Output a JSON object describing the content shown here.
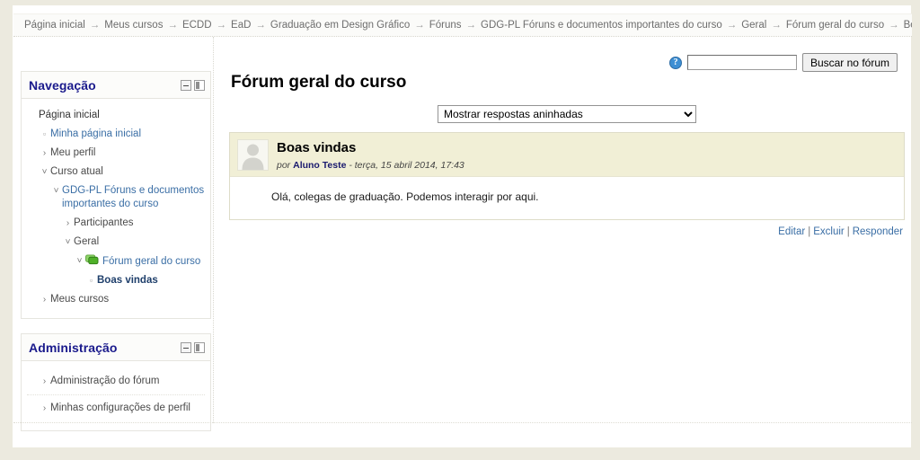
{
  "breadcrumb": {
    "separator": "→",
    "items": [
      "Página inicial",
      "Meus cursos",
      "ECDD",
      "EaD",
      "Graduação em Design Gráfico",
      "Fóruns",
      "GDG-PL Fóruns e documentos importantes do curso",
      "Geral",
      "Fórum geral do curso",
      "Boas vindas"
    ]
  },
  "search": {
    "help_icon": "help-icon",
    "input_value": "",
    "placeholder": "",
    "button_label": "Buscar no fórum"
  },
  "blocks": {
    "navigation": {
      "title": "Navegação",
      "hide_icon": "minus-icon",
      "dock_icon": "dock-icon",
      "items": [
        {
          "label": "Página inicial",
          "marker": "",
          "depth": 0,
          "style": "plain"
        },
        {
          "label": "Minha página inicial",
          "marker": "▫",
          "depth": 1,
          "style": "link"
        },
        {
          "label": "Meu perfil",
          "marker": "›",
          "depth": 1,
          "style": "muted"
        },
        {
          "label": "Curso atual",
          "marker": "˅",
          "depth": 1,
          "style": "muted"
        },
        {
          "label": "GDG-PL Fóruns e documentos importantes do curso",
          "marker": "˅",
          "depth": 2,
          "style": "link"
        },
        {
          "label": "Participantes",
          "marker": "›",
          "depth": 3,
          "style": "muted"
        },
        {
          "label": "Geral",
          "marker": "˅",
          "depth": 3,
          "style": "muted"
        },
        {
          "label": "Fórum geral do curso",
          "marker": "˅",
          "depth": 4,
          "style": "link",
          "icon": "forum-icon"
        },
        {
          "label": "Boas vindas",
          "marker": "▫",
          "depth": 5,
          "style": "bold"
        },
        {
          "label": "Meus cursos",
          "marker": "›",
          "depth": 1,
          "style": "muted"
        }
      ]
    },
    "administration": {
      "title": "Administração",
      "hide_icon": "minus-icon",
      "dock_icon": "dock-icon",
      "items": [
        {
          "label": "Administração do fórum",
          "marker": "›"
        },
        {
          "label": "Minhas configurações de perfil",
          "marker": "›"
        }
      ]
    }
  },
  "main": {
    "page_title": "Fórum geral do curso",
    "display_mode": "Mostrar respostas aninhadas",
    "display_mode_options": [
      "Mostrar respostas aninhadas"
    ],
    "post": {
      "subject": "Boas vindas",
      "by_prefix": "por",
      "author": "Aluno Teste",
      "date": "- terça, 15 abril 2014, 17:43",
      "body": "Olá, colegas de graduação. Podemos interagir por aqui.",
      "avatar_icon": "user-avatar-icon",
      "actions": [
        "Editar",
        "Excluir",
        "Responder"
      ],
      "action_separator": "|"
    }
  },
  "colors": {
    "block_title": "#1a1a8c",
    "post_header_bg": "#f1efd6",
    "link": "#3a6ea5",
    "page_bg": "#eceadf",
    "forum_icon": "#6fbf4a"
  }
}
